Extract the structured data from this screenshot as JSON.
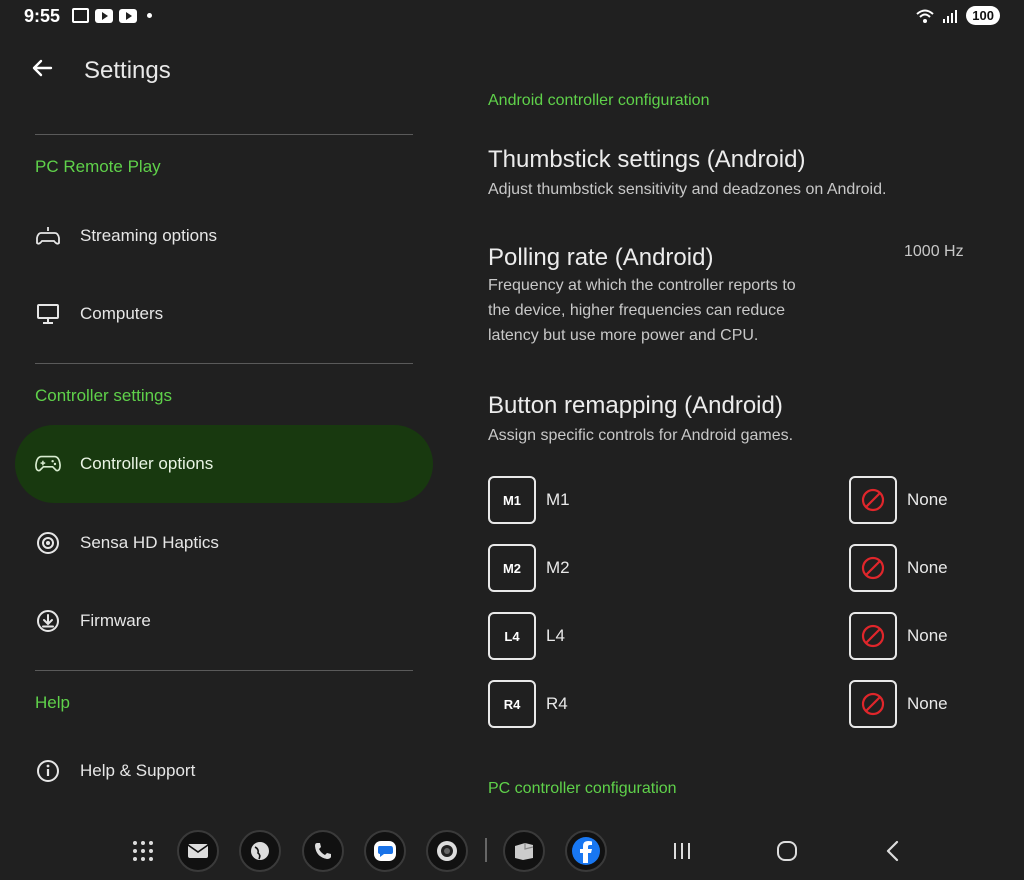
{
  "status_bar": {
    "time": "9:55",
    "battery": "100",
    "icons": [
      "screenshot-icon",
      "youtube-icon",
      "youtube-icon",
      "dot-icon",
      "wifi-icon",
      "signal-icon"
    ]
  },
  "header": {
    "title": "Settings",
    "back_icon": "back-arrow-icon"
  },
  "sidebar": {
    "sections": [
      {
        "title": "PC Remote Play",
        "items": [
          {
            "label": "Streaming options",
            "icon": "streaming-controller-icon"
          },
          {
            "label": "Computers",
            "icon": "monitor-icon"
          }
        ]
      },
      {
        "title": "Controller settings",
        "items": [
          {
            "label": "Controller options",
            "icon": "gamepad-icon",
            "active": true
          },
          {
            "label": "Sensa HD Haptics",
            "icon": "haptics-icon"
          },
          {
            "label": "Firmware",
            "icon": "download-icon"
          }
        ]
      },
      {
        "title": "Help",
        "items": [
          {
            "label": "Help & Support",
            "icon": "info-icon"
          }
        ]
      }
    ]
  },
  "main": {
    "android_section_title": "Android controller configuration",
    "thumbstick": {
      "title": "Thumbstick settings (Android)",
      "desc": "Adjust thumbstick sensitivity and deadzones on Android."
    },
    "polling": {
      "title": "Polling rate (Android)",
      "desc_lines": [
        "Frequency at which the controller reports to",
        "the device, higher frequencies can reduce",
        "latency but use more power and CPU."
      ],
      "value": "1000 Hz"
    },
    "remap": {
      "title": "Button remapping (Android)",
      "desc": "Assign specific controls for Android games.",
      "rows": [
        {
          "key": "M1",
          "label": "M1",
          "mapping": "None",
          "mapping_icon": "none-icon"
        },
        {
          "key": "M2",
          "label": "M2",
          "mapping": "None",
          "mapping_icon": "none-icon"
        },
        {
          "key": "L4",
          "label": "L4",
          "mapping": "None",
          "mapping_icon": "none-icon"
        },
        {
          "key": "R4",
          "label": "R4",
          "mapping": "None",
          "mapping_icon": "none-icon"
        }
      ]
    },
    "pc_section_title": "PC controller configuration"
  },
  "dock": {
    "apps": [
      "app-drawer-icon",
      "mail-icon",
      "browser-icon",
      "phone-icon",
      "messages-icon",
      "camera-icon",
      "files-icon",
      "facebook-icon"
    ],
    "nav": [
      "recents-icon",
      "home-icon",
      "back-icon"
    ]
  },
  "colors": {
    "accent": "#5fd14a",
    "active_bg": "#18390f",
    "bg": "#202020",
    "none_red": "#e0262b"
  }
}
